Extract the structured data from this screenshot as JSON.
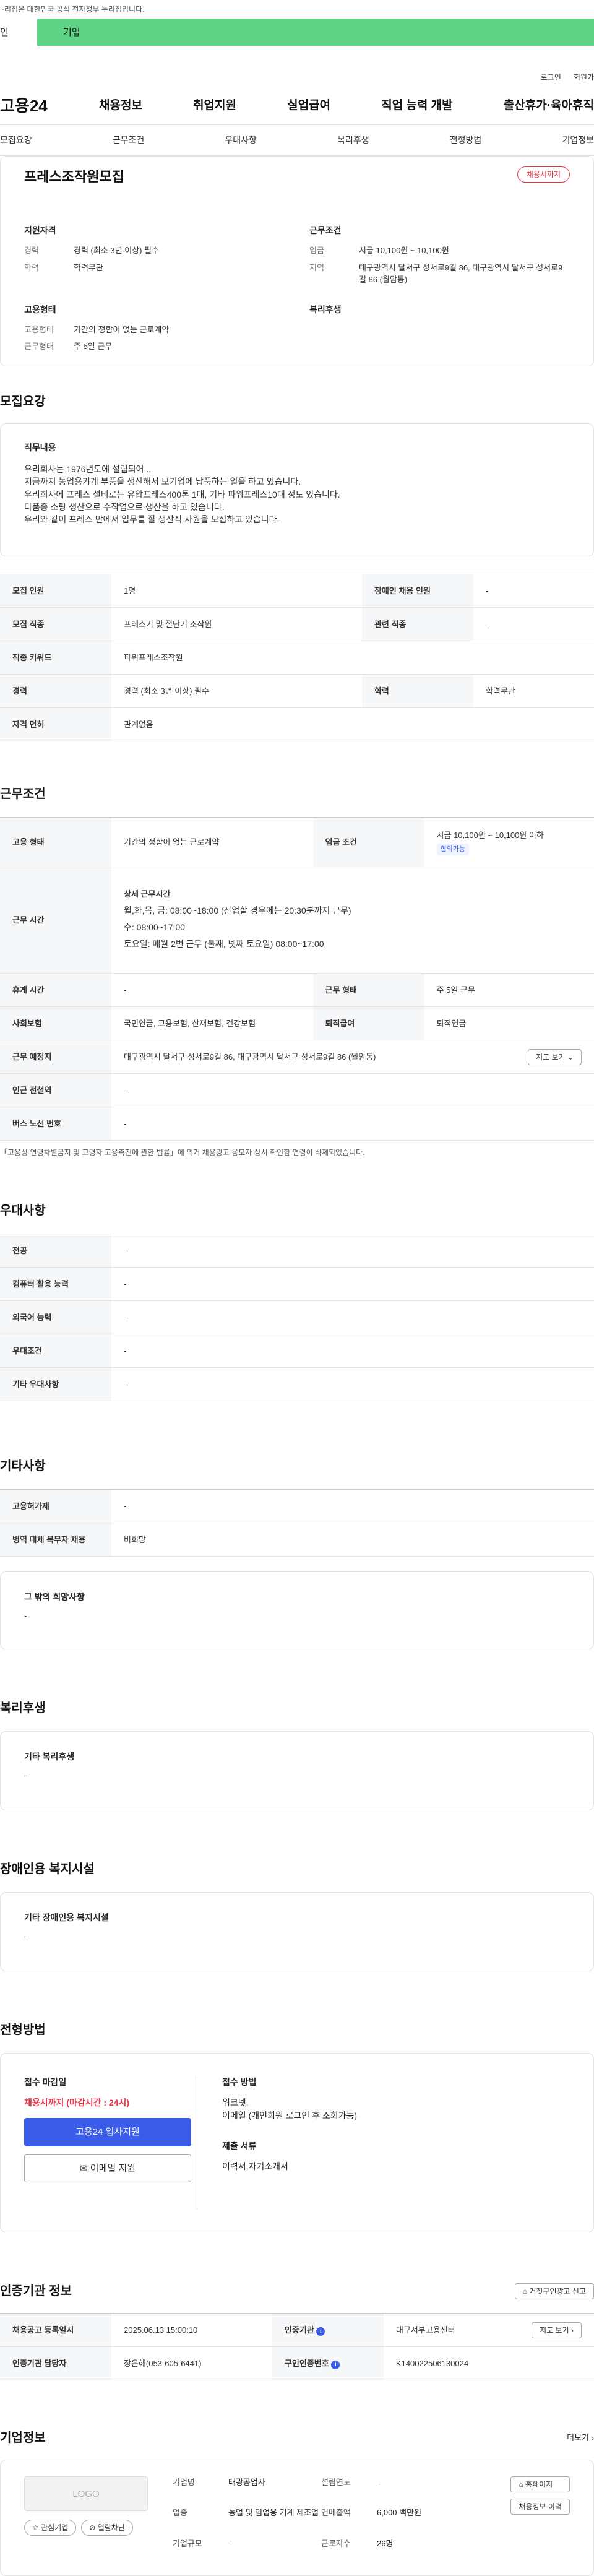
{
  "top_notice": "~리집은 대한민국 공식 전자정부 누리집입니다.",
  "user_tabs": {
    "individual": "인",
    "business": "기업"
  },
  "utility": {
    "login": "로그인",
    "signup": "회원가"
  },
  "site": {
    "logo": "고용24"
  },
  "gnb": [
    "채용정보",
    "취업지원",
    "실업급여",
    "직업 능력 개발",
    "출산휴가·육아휴직"
  ],
  "anchors": [
    "모집요강",
    "근무조건",
    "우대사항",
    "복리후생",
    "전형방법",
    "기업정보"
  ],
  "summary": {
    "title": "프레스조작원모집",
    "status_badge": "채용시까지",
    "qual_head": "지원자격",
    "work_head": "근무조건",
    "emp_head": "고용형태",
    "welfare_head": "복리후생",
    "career_k": "경력",
    "career_v": "경력 (최소 3년 이상) 필수",
    "edu_k": "학력",
    "edu_v": "학력무관",
    "wage_k": "임금",
    "wage_v": "시급 10,100원 ~ 10,100원",
    "area_k": "지역",
    "area_v": "대구광역시 달서구 성서로9길 86, 대구광역시 달서구 성서로9길 86 (월암동)",
    "type_k": "고용형태",
    "type_v": "기간의 정함이 없는 근로계약",
    "form_k": "근무형태",
    "form_v": "주 5일 근무"
  },
  "recruit": {
    "title": "모집요강",
    "duty_head": "직무내용",
    "duty_lines": [
      "우리회사는 1976년도에 설립되어...",
      "지금까지 농업용기계 부품을 생산해서 모기업에 납품하는 일을 하고 있습니다.",
      "우리회사에 프레스 설비로는 유압프레스400톤 1대, 기타 파워프레스10대 정도 있습니다.",
      "다품종 소량 생산으로 수작업으로 생산을 하고 있습니다.",
      "우리와 같이 프레스 반에서 업무를 잘 생산직 사원을 모집하고 있습니다."
    ],
    "rows": [
      {
        "k1": "모집 인원",
        "v1": "1명",
        "k2": "장애인 채용 인원",
        "v2": "-"
      },
      {
        "k1": "모집 직종",
        "v1": "프레스기 및 절단기 조작원",
        "k2": "관련 직종",
        "v2": "-"
      },
      {
        "k1": "직종 키워드",
        "v1": "파워프레스조작원",
        "k2": "",
        "v2": ""
      },
      {
        "k1": "경력",
        "v1": "경력 (최소 3년 이상) 필수",
        "k2": "학력",
        "v2": "학력무관"
      },
      {
        "k1": "자격 면허",
        "v1": "관계없음",
        "k2": "",
        "v2": ""
      }
    ]
  },
  "conditions": {
    "title": "근무조건",
    "emp_type_k": "고용 형태",
    "emp_type_v": "기간의 정함이 없는 근로계약",
    "wage_k": "임금 조건",
    "wage_v": "시급 10,100원 ~ 10,100원 이하",
    "wage_tag": "협의가능",
    "hours_k": "근무 시간",
    "hours_head": "상세 근무시간",
    "hours_lines": [
      "월,화,목, 금: 08:00~18:00 (잔업할 경우에는 20:30분까지 근무)",
      "수: 08:00~17:00",
      "토요일: 매월 2번 근무 (둘째, 넷째 토요일) 08:00~17:00"
    ],
    "leave_k": "휴게 시간",
    "leave_v": "-",
    "form_k": "근무 형태",
    "form_v": "주 5일 근무",
    "insurance_k": "사회보험",
    "insurance_v": "국민연금, 고용보험, 산재보험, 건강보험",
    "retire_k": "퇴직급여",
    "retire_v": "퇴직연금",
    "place_k": "근무 예정지",
    "place_v": "대구광역시 달서구 성서로9길 86, 대구광역시 달서구 성서로9길 86 (월암동)",
    "map_btn": "지도 보기",
    "subway_k": "인근 전철역",
    "subway_v": "-",
    "bus_k": "버스 노선 번호",
    "bus_v": "-",
    "note": "「고용상 연령차별금지 및 고령자 고용촉진에 관한 법률」에 의거 채용광고 응모자 상시 확인함 연령이 삭제되었습니다."
  },
  "preference": {
    "title": "우대사항",
    "rows": [
      {
        "k": "전공",
        "v": "-"
      },
      {
        "k": "컴퓨터 활용 능력",
        "v": "-"
      },
      {
        "k": "외국어 능력",
        "v": "-"
      },
      {
        "k": "우대조건",
        "v": "-"
      },
      {
        "k": "기타 우대사항",
        "v": "-"
      }
    ]
  },
  "etc": {
    "title": "기타사항",
    "rows": [
      {
        "k": "고용허가제",
        "v": "-"
      },
      {
        "k": "병역 대체 복무자 채용",
        "v": "비희망"
      }
    ],
    "other_head": "그 밖의 희망사항",
    "other_v": "-"
  },
  "welfare": {
    "title": "복리후생",
    "head": "기타 복리후생",
    "value": "-"
  },
  "disability": {
    "title": "장애인용 복지시설",
    "head": "기타 장애인용 복지시설",
    "value": "-"
  },
  "selection": {
    "title": "전형방법",
    "deadline_head": "접수 마감일",
    "deadline_v": "채용시까지 (마감시간 : 24시)",
    "apply_btn": "고용24 입사지원",
    "email_btn": "이메일 지원",
    "method_head": "접수 방법",
    "method_lines": [
      "워크넷,",
      "이메일 (개인회원 로그인 후 조회가능)"
    ],
    "docs_head": "제출 서류",
    "docs_v": "이력서,자기소개서"
  },
  "cert": {
    "title": "인증기관 정보",
    "report_btn": "거짓구인광고 신고",
    "reg_k": "채용공고 등록일시",
    "reg_v": "2025.06.13 15:00:10",
    "org_k": "인증기관",
    "org_v": "대구서부고용센터",
    "map_btn": "지도 보기",
    "staff_k": "인증기관 담당자",
    "staff_v": "장은혜(053-605-6441)",
    "no_k": "구인인증번호",
    "no_v": "K140022506130024"
  },
  "company": {
    "title": "기업정보",
    "more": "더보기",
    "logo_placeholder": "LOGO",
    "interest_btn": "관심기업",
    "block_btn": "열람차단",
    "name_k": "기업명",
    "name_v": "태광공업사",
    "industry_k": "업종",
    "industry_v": "농업 및 임업용 기계 제조업",
    "size_k": "기업규모",
    "size_v": "-",
    "founded_k": "설립연도",
    "founded_v": "-",
    "sales_k": "연매출액",
    "sales_v": "6,000 백만원",
    "workers_k": "근로자수",
    "workers_v": "26명",
    "homepage_btn": "홈페이지",
    "jobs_btn": "채용정보 이력"
  }
}
